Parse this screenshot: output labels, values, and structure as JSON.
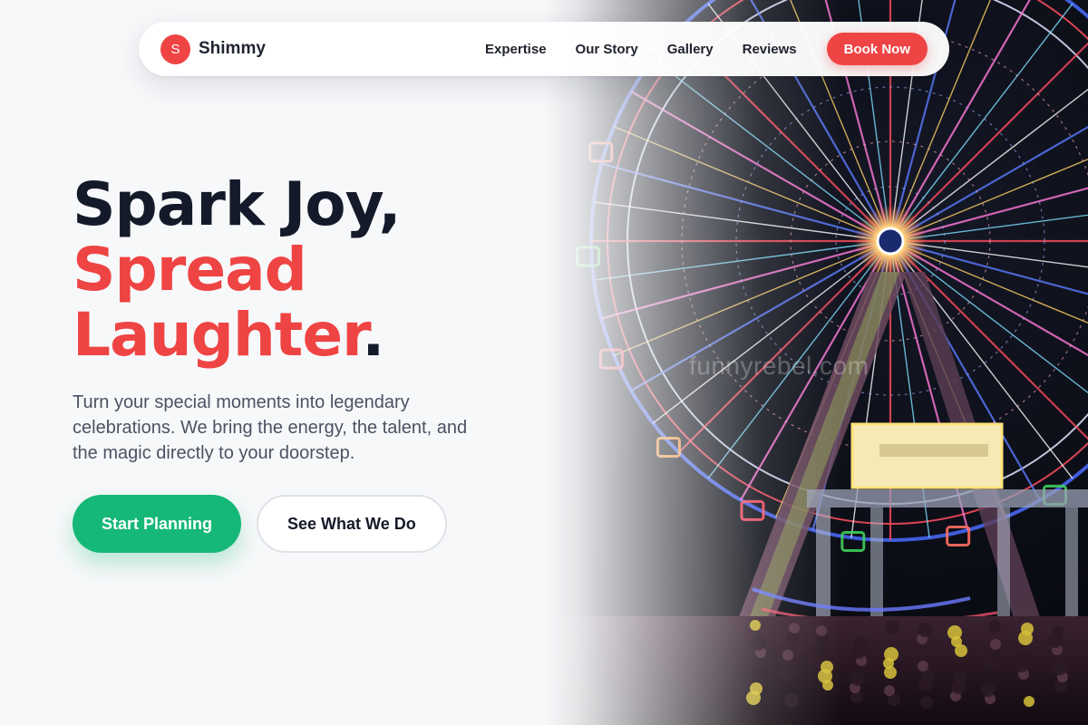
{
  "brand": {
    "logo_letter": "S",
    "name": "Shimmy"
  },
  "nav": {
    "items": [
      {
        "label": "Expertise"
      },
      {
        "label": "Our Story"
      },
      {
        "label": "Gallery"
      },
      {
        "label": "Reviews"
      }
    ],
    "cta_label": "Book Now"
  },
  "hero": {
    "headline_line1": "Spark Joy,",
    "headline_line2": "Spread",
    "headline_line3": "Laughter",
    "headline_period": ".",
    "subtitle": "Turn your special moments into legendary celebrations. We bring the energy, the talent, and the magic directly to your doorstep.",
    "primary_cta": "Start Planning",
    "secondary_cta": "See What We Do",
    "image_watermark": "funnyrebel.com"
  },
  "colors": {
    "accent_red": "#ef4444",
    "accent_green": "#16b877",
    "heading_dark": "#141a29",
    "body_text": "#4b5263",
    "background": "#f7f8fa"
  }
}
